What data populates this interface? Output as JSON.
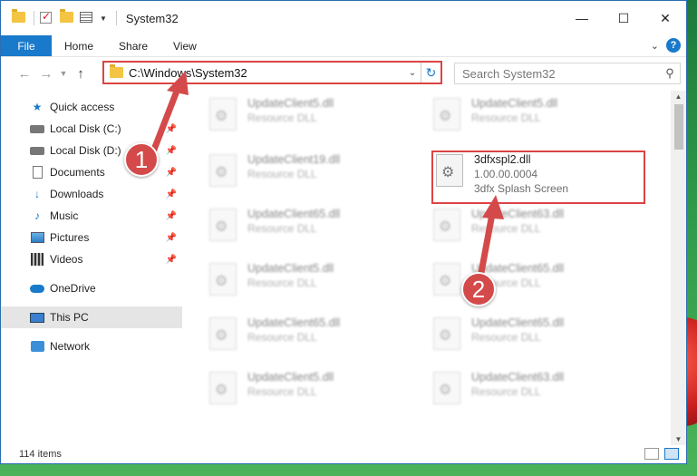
{
  "titlebar": {
    "title": "System32"
  },
  "ribbon": {
    "tabs": [
      "File",
      "Home",
      "Share",
      "View"
    ],
    "help": "?"
  },
  "nav": {
    "address": "C:\\Windows\\System32",
    "search_placeholder": "Search System32"
  },
  "sidebar": {
    "items": [
      {
        "label": "Quick access",
        "icon": "star-icon"
      },
      {
        "label": "Local Disk (C:)",
        "icon": "disk-icon",
        "pinned": true
      },
      {
        "label": "Local Disk (D:)",
        "icon": "disk-icon",
        "pinned": true
      },
      {
        "label": "Documents",
        "icon": "document-icon",
        "pinned": true
      },
      {
        "label": "Downloads",
        "icon": "download-icon",
        "pinned": true
      },
      {
        "label": "Music",
        "icon": "music-icon",
        "pinned": true
      },
      {
        "label": "Pictures",
        "icon": "pictures-icon",
        "pinned": true
      },
      {
        "label": "Videos",
        "icon": "videos-icon",
        "pinned": true
      },
      {
        "label": "OneDrive",
        "icon": "cloud-icon"
      },
      {
        "label": "This PC",
        "icon": "pc-icon",
        "selected": true
      },
      {
        "label": "Network",
        "icon": "network-icon"
      }
    ]
  },
  "files": [
    {
      "name": "UpdateClient5.dll",
      "sub": "Resource DLL"
    },
    {
      "name": "UpdateClient5.dll",
      "sub": "Resource DLL"
    },
    {
      "name": "UpdateClient19.dll",
      "sub": "Resource DLL"
    },
    {
      "name": "3dfxspl2.dll",
      "version": "1.00.00.0004",
      "sub": "3dfx Splash Screen",
      "highlighted": true
    },
    {
      "name": "UpdateClient65.dll",
      "sub": "Resource DLL"
    },
    {
      "name": "UpdateClient63.dll",
      "sub": "Resource DLL"
    },
    {
      "name": "UpdateClient5.dll",
      "sub": "Resource DLL"
    },
    {
      "name": "UpdateClient65.dll",
      "sub": "Resource DLL"
    },
    {
      "name": "UpdateClient65.dll",
      "sub": "Resource DLL"
    },
    {
      "name": "UpdateClient65.dll",
      "sub": "Resource DLL"
    },
    {
      "name": "UpdateClient5.dll",
      "sub": "Resource DLL"
    },
    {
      "name": "UpdateClient63.dll",
      "sub": "Resource DLL"
    }
  ],
  "status": {
    "items_count": "114 items"
  },
  "annotations": {
    "badge1": "1",
    "badge2": "2",
    "color": "#d44a4a"
  }
}
